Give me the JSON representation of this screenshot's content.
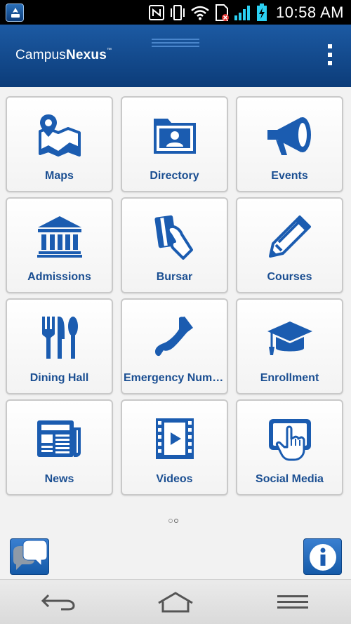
{
  "status_bar": {
    "time": "10:58 AM",
    "icons": [
      "app-icon",
      "nfc-icon",
      "vibrate-icon",
      "wifi-icon",
      "sim-card-no-signal-icon",
      "signal-icon",
      "battery-charging-icon"
    ]
  },
  "header": {
    "brand_light": "Campus",
    "brand_bold": "Nexus",
    "brand_tm": "™",
    "menu_icon": "overflow-menu-icon"
  },
  "tiles": [
    {
      "label": "Maps",
      "icon": "map-pin-icon"
    },
    {
      "label": "Directory",
      "icon": "contact-folder-icon"
    },
    {
      "label": "Events",
      "icon": "megaphone-icon"
    },
    {
      "label": "Admissions",
      "icon": "building-columns-icon"
    },
    {
      "label": "Bursar",
      "icon": "card-hand-icon"
    },
    {
      "label": "Courses",
      "icon": "pencil-icon"
    },
    {
      "label": "Dining Hall",
      "icon": "fork-knife-icon"
    },
    {
      "label": "Emergency Numb…",
      "icon": "phone-icon"
    },
    {
      "label": "Enrollment",
      "icon": "graduation-cap-icon"
    },
    {
      "label": "News",
      "icon": "newspaper-icon"
    },
    {
      "label": "Videos",
      "icon": "film-play-icon"
    },
    {
      "label": "Social Media",
      "icon": "touch-screen-icon"
    }
  ],
  "pagination": {
    "pages": 2,
    "current": 2
  },
  "bottom_buttons": {
    "chat_icon": "chat-bubbles-icon",
    "info_icon": "info-icon"
  },
  "nav_bar": {
    "icons": [
      "back-icon",
      "home-icon",
      "menu-icon"
    ]
  },
  "colors": {
    "header": "#1c5aa3",
    "accent": "#1b5cb0",
    "label": "#1b4f92",
    "tile_border": "#c9c9c9"
  }
}
